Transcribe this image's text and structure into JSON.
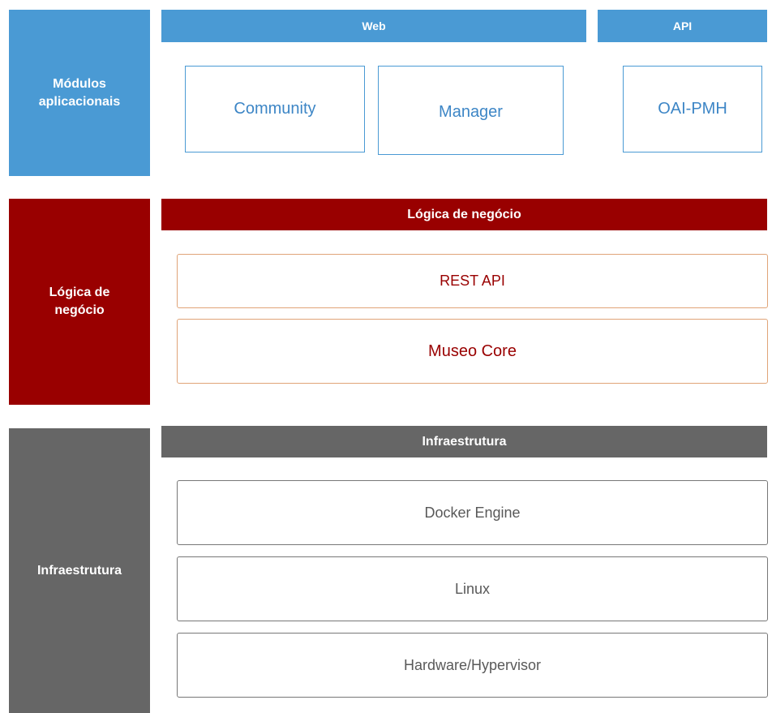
{
  "colors": {
    "application_layer": "#4a9ad4",
    "business_layer": "#990000",
    "infrastructure_layer": "#666666"
  },
  "layers": {
    "application": {
      "label": "Módulos\naplicacionais",
      "groups": {
        "web": {
          "label": "Web",
          "modules": [
            "Community",
            "Manager"
          ]
        },
        "api": {
          "label": "API",
          "modules": [
            "OAI-PMH"
          ]
        }
      }
    },
    "business": {
      "label": "Lógica de\nnegócio",
      "header": "Lógica de negócio",
      "components": [
        "REST API",
        "Museo Core"
      ]
    },
    "infrastructure": {
      "label": "Infraestrutura",
      "header": "Infraestrutura",
      "components": [
        "Docker Engine",
        "Linux",
        "Hardware/Hypervisor"
      ]
    }
  }
}
